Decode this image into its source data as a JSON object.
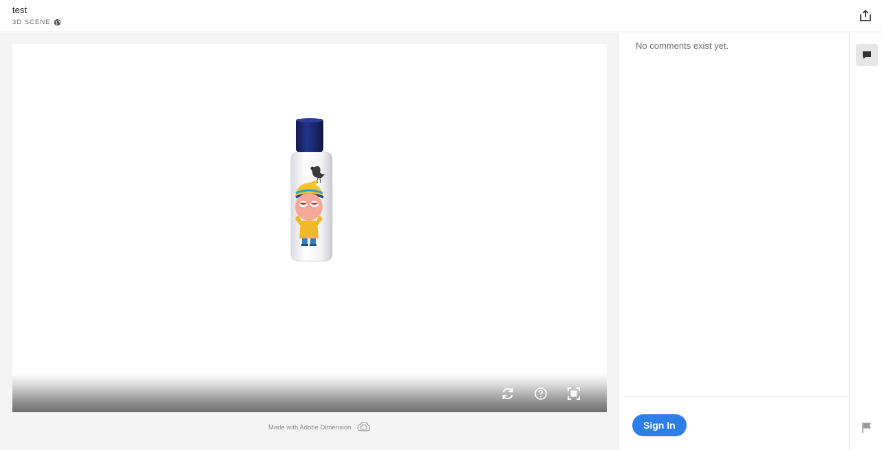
{
  "header": {
    "title": "test",
    "subtitle": "3D SCENE"
  },
  "icons": {
    "visibility": "globe-icon",
    "share": "share-icon",
    "rotate": "rotate-icon",
    "help": "help-icon",
    "fullscreen": "fullscreen-icon",
    "comments": "comment-icon",
    "flag": "flag-icon",
    "creative_cloud": "creative-cloud-icon"
  },
  "viewer": {
    "footer_text": "Made with Adobe Dimension"
  },
  "comments": {
    "empty_text": "No comments exist yet.",
    "sign_in_label": "Sign In"
  },
  "colors": {
    "accent": "#2d7ee8",
    "cap": "#1c2a6e",
    "bottle": "#f3f3f5"
  }
}
